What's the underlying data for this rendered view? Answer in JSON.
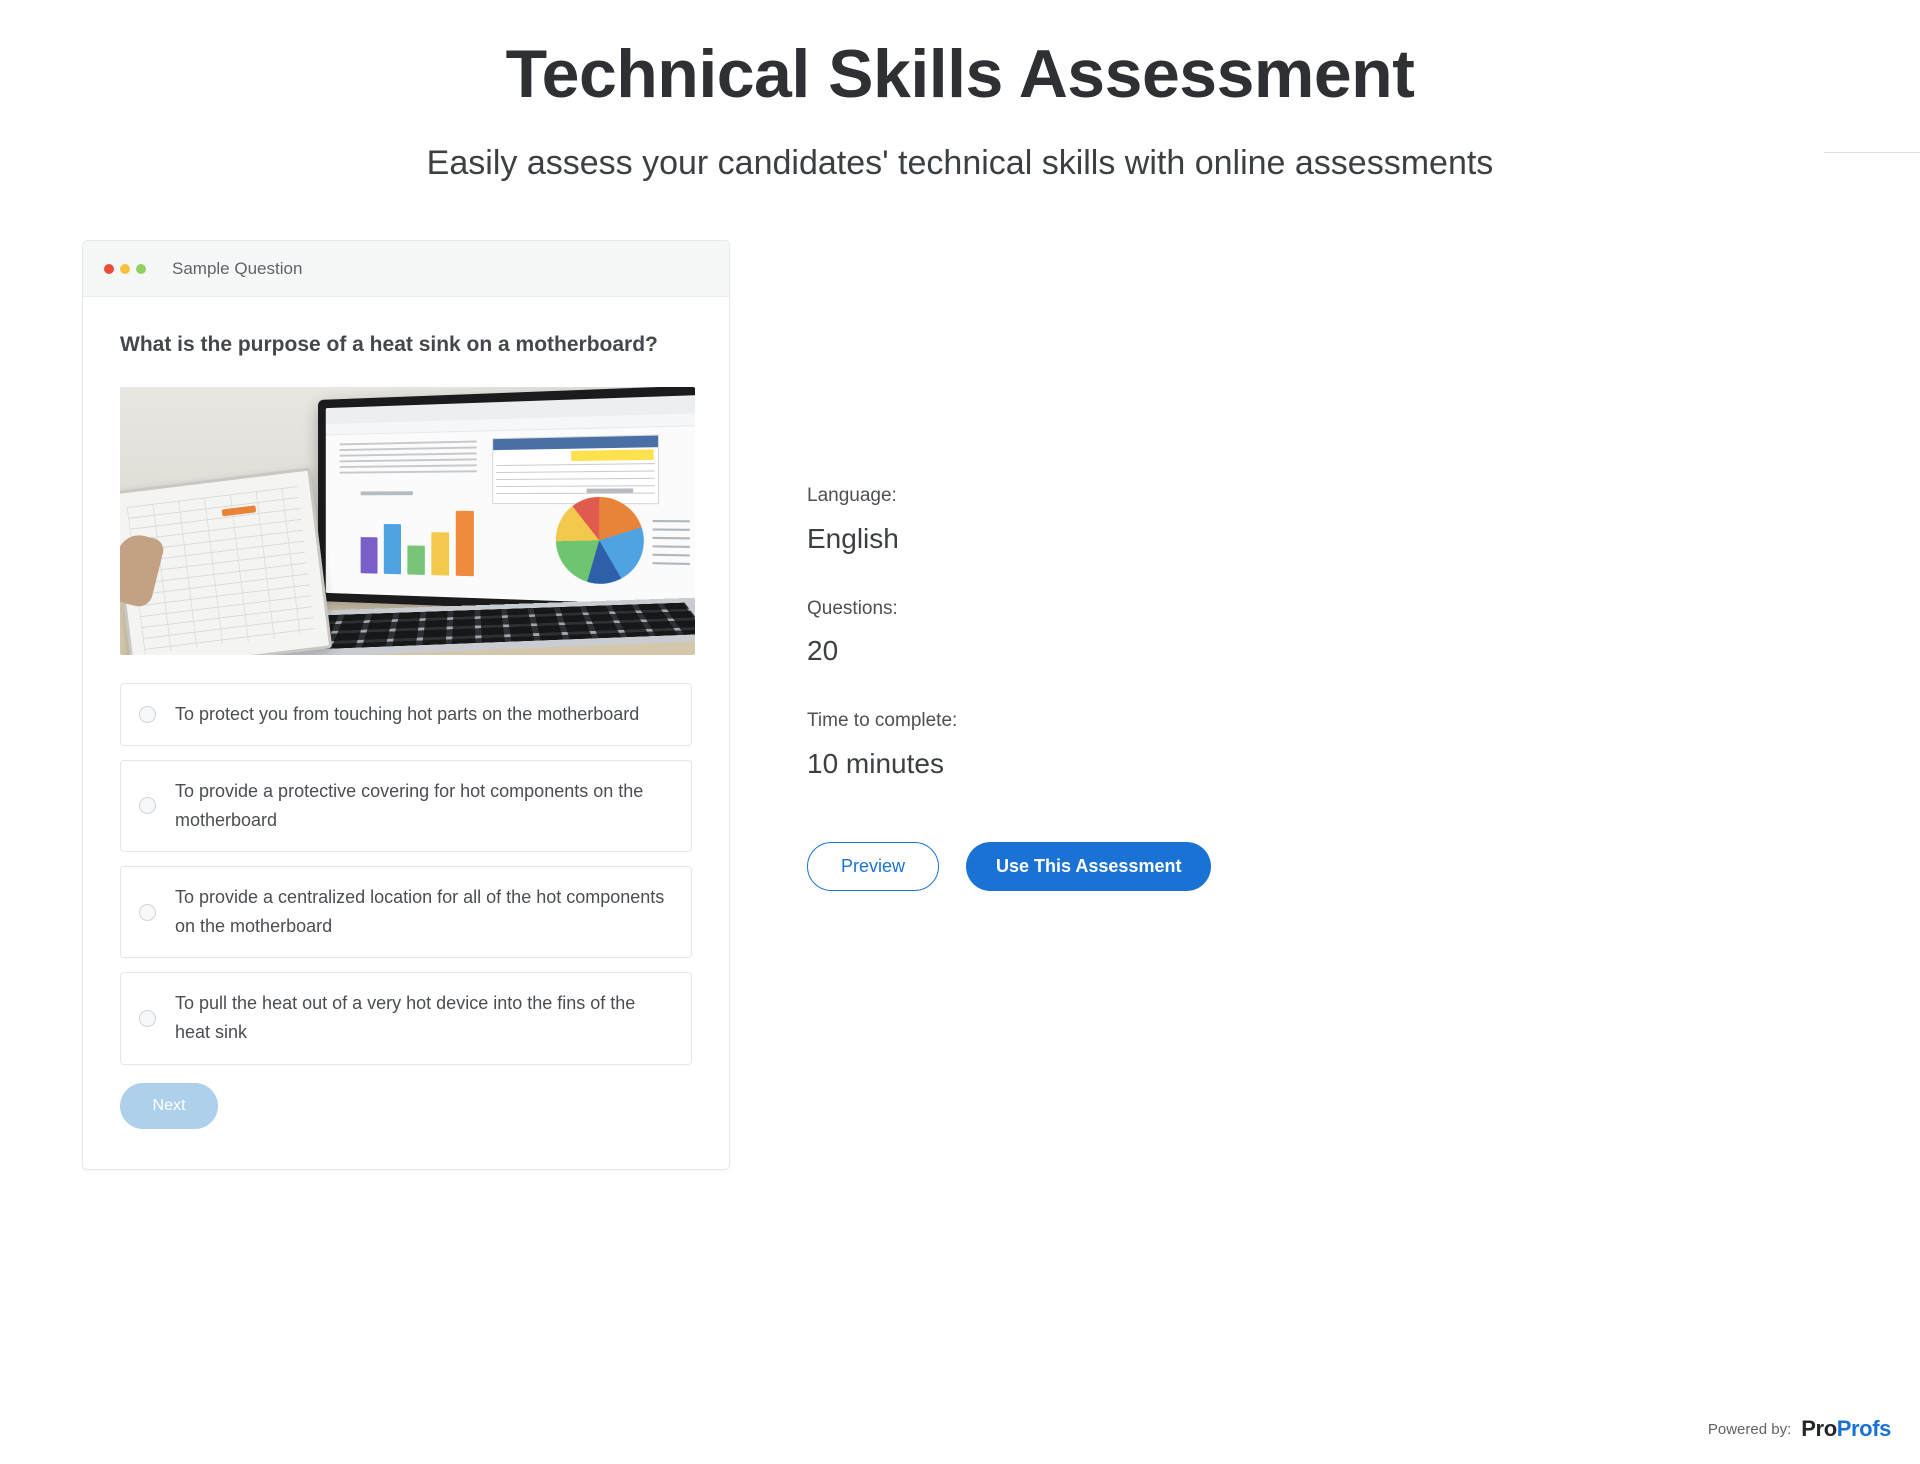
{
  "header": {
    "title": "Technical Skills Assessment",
    "subtitle": "Easily assess your candidates' technical skills with online assessments"
  },
  "card": {
    "window_title": "Sample Question",
    "traffic_lights": [
      {
        "name": "close-dot",
        "color": "#ee4b3b"
      },
      {
        "name": "minimize-dot",
        "color": "#f5c33b"
      },
      {
        "name": "maximize-dot",
        "color": "#8ed15e"
      }
    ],
    "question": "What is the purpose of a heat sink on a motherboard?",
    "image_alt": "laptop-with-charts-photo",
    "options": [
      {
        "label": "To protect you from touching hot parts on the motherboard",
        "selected": false
      },
      {
        "label": "To provide a protective covering for hot components on the motherboard",
        "selected": false
      },
      {
        "label": "To provide a centralized location for all of the hot components on the motherboard",
        "selected": false
      },
      {
        "label": "To pull the heat out of a very hot device into the fins of the heat sink",
        "selected": false
      }
    ],
    "next_label": "Next"
  },
  "meta": {
    "language_label": "Language:",
    "language_value": "English",
    "questions_label": "Questions:",
    "questions_value": "20",
    "time_label": "Time to complete:",
    "time_value": "10 minutes",
    "preview_label": "Preview",
    "use_label": "Use This Assessment"
  },
  "footer": {
    "powered_by": "Powered by:",
    "brand_first": "Pro",
    "brand_second": "Profs"
  },
  "colors": {
    "primary": "#1a73d4",
    "next_disabled": "#aed0ea",
    "title": "#2f3033",
    "body_text": "#4a4e53"
  }
}
